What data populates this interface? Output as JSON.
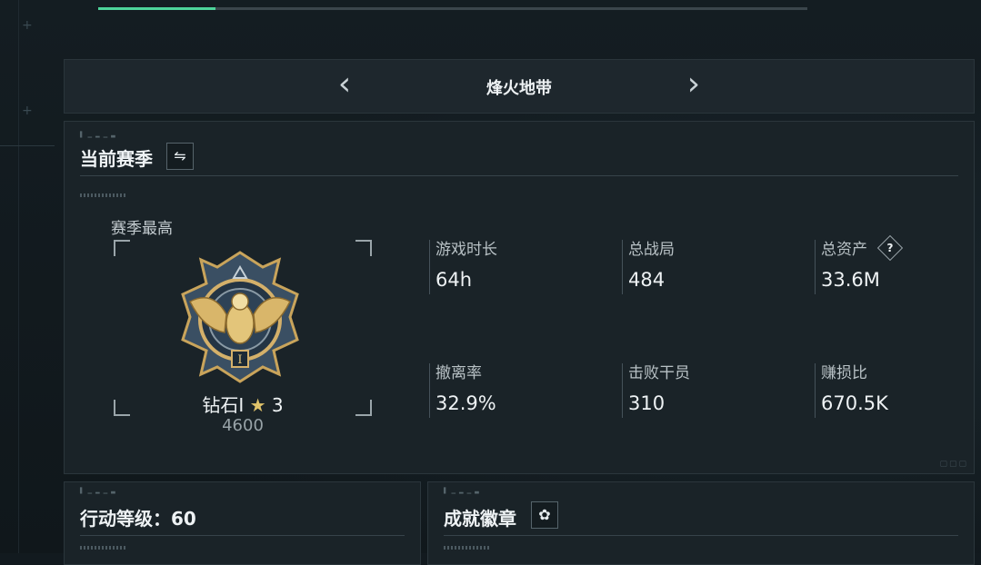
{
  "top_progress": {
    "fraction": 0.166
  },
  "mode": {
    "title": "烽火地带",
    "prev_icon": "chevron-left-icon",
    "next_icon": "chevron-right-icon"
  },
  "season_panel": {
    "title": "当前赛季",
    "switch_icon": "swap-icon",
    "switch_glyph": "⇋",
    "best_label": "赛季最高",
    "rank": {
      "name": "钻石I",
      "star_glyph": "★",
      "stars": "3",
      "score": "4600",
      "emblem_numeral": "I"
    },
    "stats": [
      {
        "label": "游戏时长",
        "value": "64h"
      },
      {
        "label": "总战局",
        "value": "484"
      },
      {
        "label": "总资产",
        "value": "33.6M",
        "help": "?"
      },
      {
        "label": "撤离率",
        "value": "32.9%"
      },
      {
        "label": "击败干员",
        "value": "310"
      },
      {
        "label": "赚损比",
        "value": "670.5K"
      }
    ]
  },
  "level_panel": {
    "title": "行动等级：60"
  },
  "badge_panel": {
    "title": "成就徽章",
    "settings_icon": "gear-icon",
    "settings_glyph": "✿"
  },
  "colors": {
    "accent": "#4dd39a",
    "gold": "#d9b66a",
    "panel": "#1a2328"
  }
}
